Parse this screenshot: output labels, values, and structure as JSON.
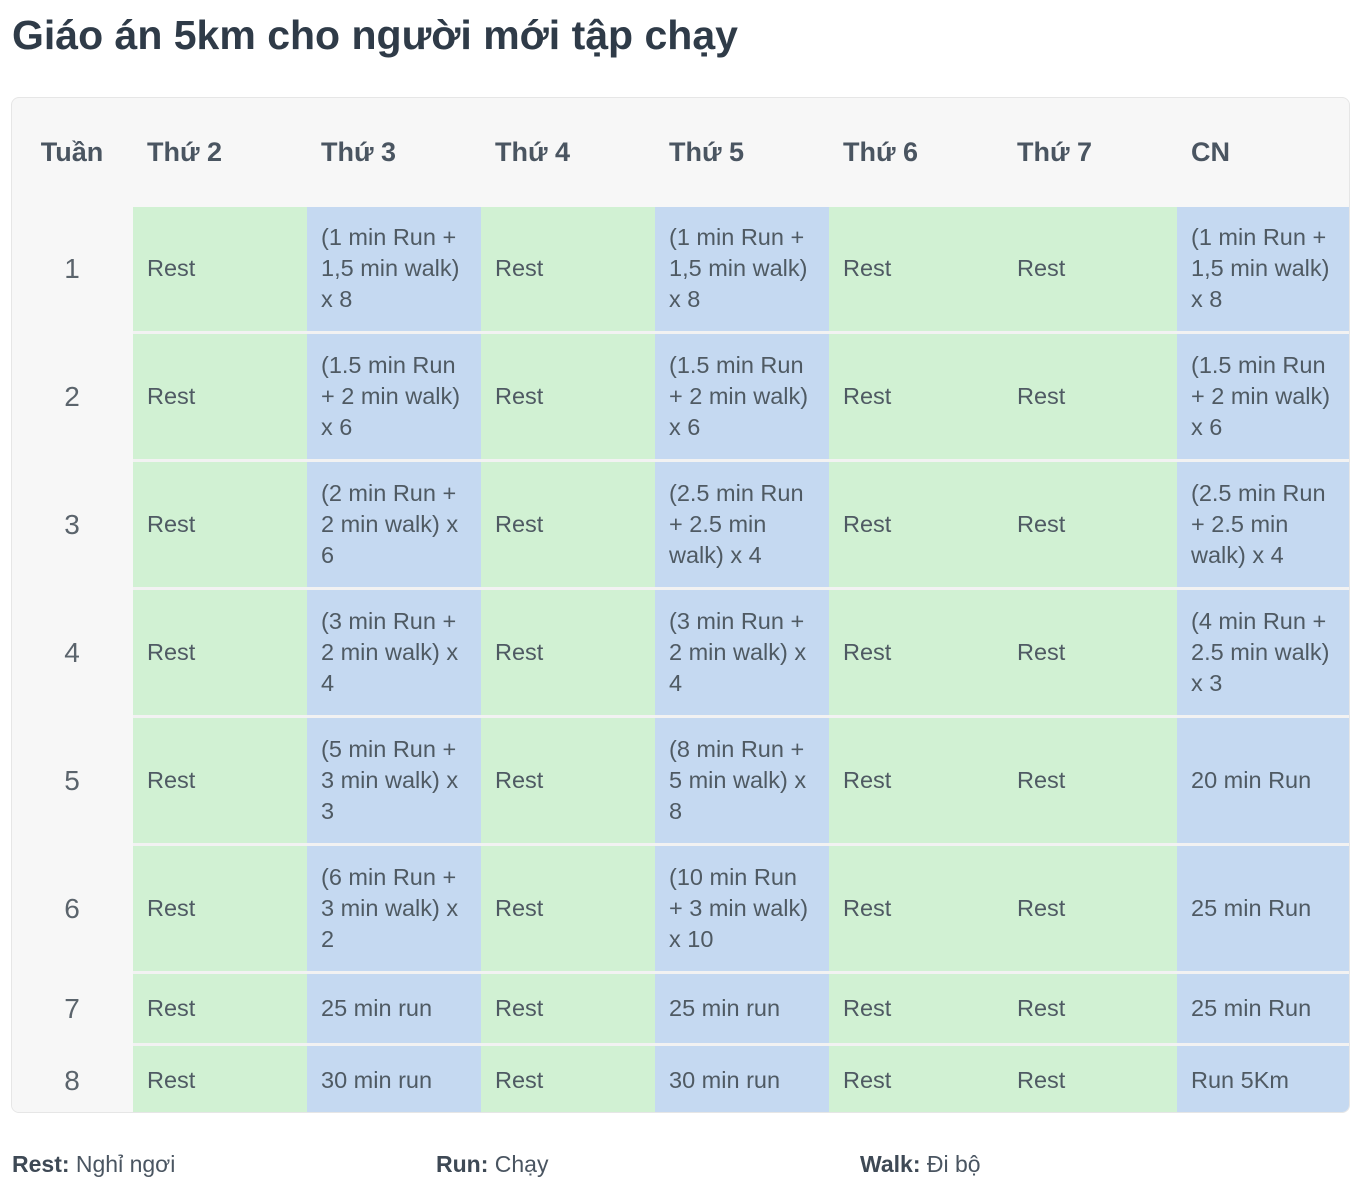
{
  "title": "Giáo án 5km cho người mới tập chạy",
  "headers": [
    "Tuần",
    "Thứ 2",
    "Thứ 3",
    "Thứ 4",
    "Thứ 5",
    "Thứ 6",
    "Thứ 7",
    "CN"
  ],
  "rows": [
    {
      "week": "1",
      "cells": [
        "Rest",
        "(1 min Run + 1,5 min walk) x 8",
        "Rest",
        "(1 min Run + 1,5 min walk) x 8",
        "Rest",
        "Rest",
        "(1 min Run + 1,5 min walk) x 8"
      ]
    },
    {
      "week": "2",
      "cells": [
        "Rest",
        "(1.5 min Run + 2 min walk) x 6",
        "Rest",
        "(1.5 min Run + 2 min walk) x 6",
        "Rest",
        "Rest",
        "(1.5 min Run + 2 min walk) x 6"
      ]
    },
    {
      "week": "3",
      "cells": [
        "Rest",
        "(2 min Run + 2 min walk) x 6",
        "Rest",
        "(2.5 min Run + 2.5 min walk) x 4",
        "Rest",
        "Rest",
        "(2.5 min Run + 2.5 min walk) x 4"
      ]
    },
    {
      "week": "4",
      "cells": [
        "Rest",
        "(3 min Run + 2 min walk) x 4",
        "Rest",
        "(3 min Run + 2 min walk) x 4",
        "Rest",
        "Rest",
        "(4 min Run + 2.5 min walk) x 3"
      ]
    },
    {
      "week": "5",
      "cells": [
        "Rest",
        "(5 min Run + 3 min walk) x 3",
        "Rest",
        "(8 min Run + 5 min walk) x 8",
        "Rest",
        "Rest",
        "20 min Run"
      ]
    },
    {
      "week": "6",
      "cells": [
        "Rest",
        "(6 min Run + 3 min walk) x 2",
        "Rest",
        "(10 min Run + 3 min walk) x 10",
        "Rest",
        "Rest",
        "25 min Run"
      ]
    },
    {
      "week": "7",
      "cells": [
        "Rest",
        "25 min run",
        "Rest",
        "25 min run",
        "Rest",
        "Rest",
        "25 min Run"
      ]
    },
    {
      "week": "8",
      "cells": [
        "Rest",
        "30 min run",
        "Rest",
        "30 min run",
        "Rest",
        "Rest",
        "Run 5Km"
      ]
    }
  ],
  "legend": [
    {
      "term": "Rest:",
      "meaning": "Nghỉ ngơi"
    },
    {
      "term": "Run:",
      "meaning": "Chạy"
    },
    {
      "term": "Walk:",
      "meaning": "Đi bộ"
    }
  ],
  "colors": {
    "rest_cell": "#d1f1d3",
    "run_cell": "#c5d9f1",
    "card_background": "#f7f7f7"
  }
}
